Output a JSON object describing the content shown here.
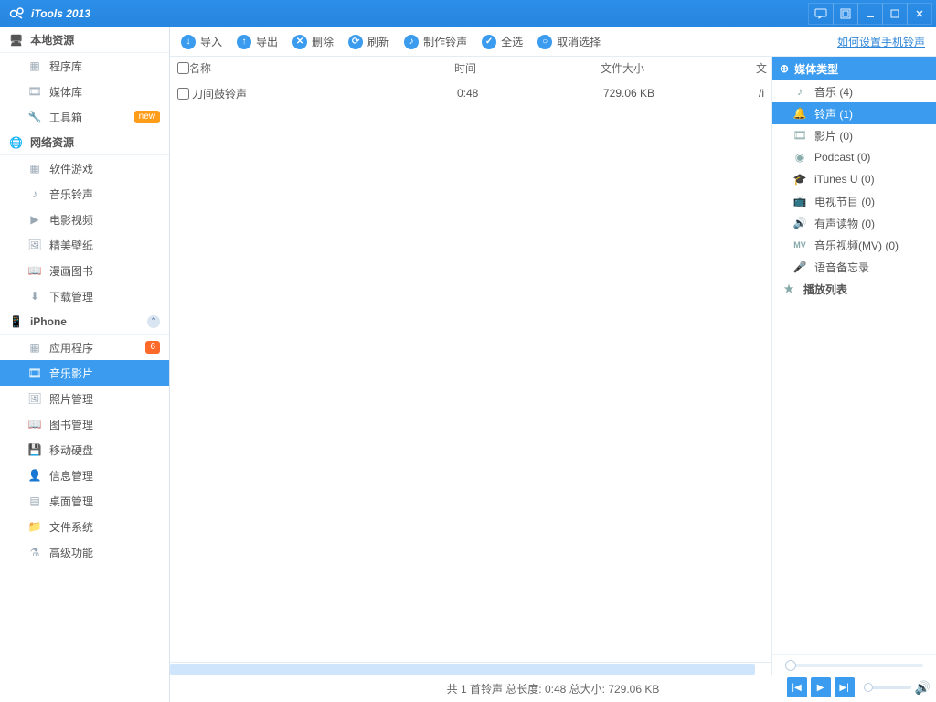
{
  "app": {
    "title": "iTools 2013"
  },
  "sidebar": {
    "sections": [
      {
        "label": "本地资源",
        "items": [
          {
            "label": "程序库",
            "icon": "grid"
          },
          {
            "label": "媒体库",
            "icon": "film"
          },
          {
            "label": "工具箱",
            "icon": "wrench",
            "badge": "new",
            "badgeColor": "orange"
          }
        ]
      },
      {
        "label": "网络资源",
        "items": [
          {
            "label": "软件游戏",
            "icon": "grid"
          },
          {
            "label": "音乐铃声",
            "icon": "note"
          },
          {
            "label": "电影视频",
            "icon": "play"
          },
          {
            "label": "精美壁纸",
            "icon": "image"
          },
          {
            "label": "漫画图书",
            "icon": "book"
          },
          {
            "label": "下载管理",
            "icon": "download"
          }
        ]
      },
      {
        "label": "iPhone",
        "chevron": true,
        "items": [
          {
            "label": "应用程序",
            "icon": "grid",
            "badge": "6",
            "badgeColor": "red"
          },
          {
            "label": "音乐影片",
            "icon": "film",
            "active": true
          },
          {
            "label": "照片管理",
            "icon": "image"
          },
          {
            "label": "图书管理",
            "icon": "book"
          },
          {
            "label": "移动硬盘",
            "icon": "disk"
          },
          {
            "label": "信息管理",
            "icon": "person"
          },
          {
            "label": "桌面管理",
            "icon": "layout"
          },
          {
            "label": "文件系统",
            "icon": "folder"
          },
          {
            "label": "高级功能",
            "icon": "flask"
          }
        ]
      }
    ]
  },
  "toolbar": {
    "buttons": [
      {
        "label": "导入",
        "glyph": "↓"
      },
      {
        "label": "导出",
        "glyph": "↑"
      },
      {
        "label": "删除",
        "glyph": "✕"
      },
      {
        "label": "刷新",
        "glyph": "⟳"
      },
      {
        "label": "制作铃声",
        "glyph": "♪"
      },
      {
        "label": "全选",
        "glyph": "✓"
      },
      {
        "label": "取消选择",
        "glyph": "○"
      }
    ],
    "link": "如何设置手机铃声"
  },
  "table": {
    "headers": {
      "name": "名称",
      "time": "时间",
      "size": "文件大小",
      "ext": "文"
    },
    "rows": [
      {
        "name": "刀间鼓铃声",
        "time": "0:48",
        "size": "729.06 KB",
        "ext": "/i"
      }
    ]
  },
  "rightpanel": {
    "header": "媒体类型",
    "items": [
      {
        "label": "音乐 (4)",
        "icon": "note"
      },
      {
        "label": "铃声 (1)",
        "icon": "bell",
        "active": true
      },
      {
        "label": "影片 (0)",
        "icon": "film"
      },
      {
        "label": "Podcast (0)",
        "icon": "podcast"
      },
      {
        "label": "iTunes U (0)",
        "icon": "hat"
      },
      {
        "label": "电视节目 (0)",
        "icon": "tv"
      },
      {
        "label": "有声读物 (0)",
        "icon": "audiobook"
      },
      {
        "label": "音乐视频(MV) (0)",
        "icon": "mv"
      },
      {
        "label": "语音备忘录",
        "icon": "mic"
      }
    ],
    "playlist": "播放列表"
  },
  "status": "共 1 首铃声   总长度: 0:48   总大小: 729.06 KB"
}
